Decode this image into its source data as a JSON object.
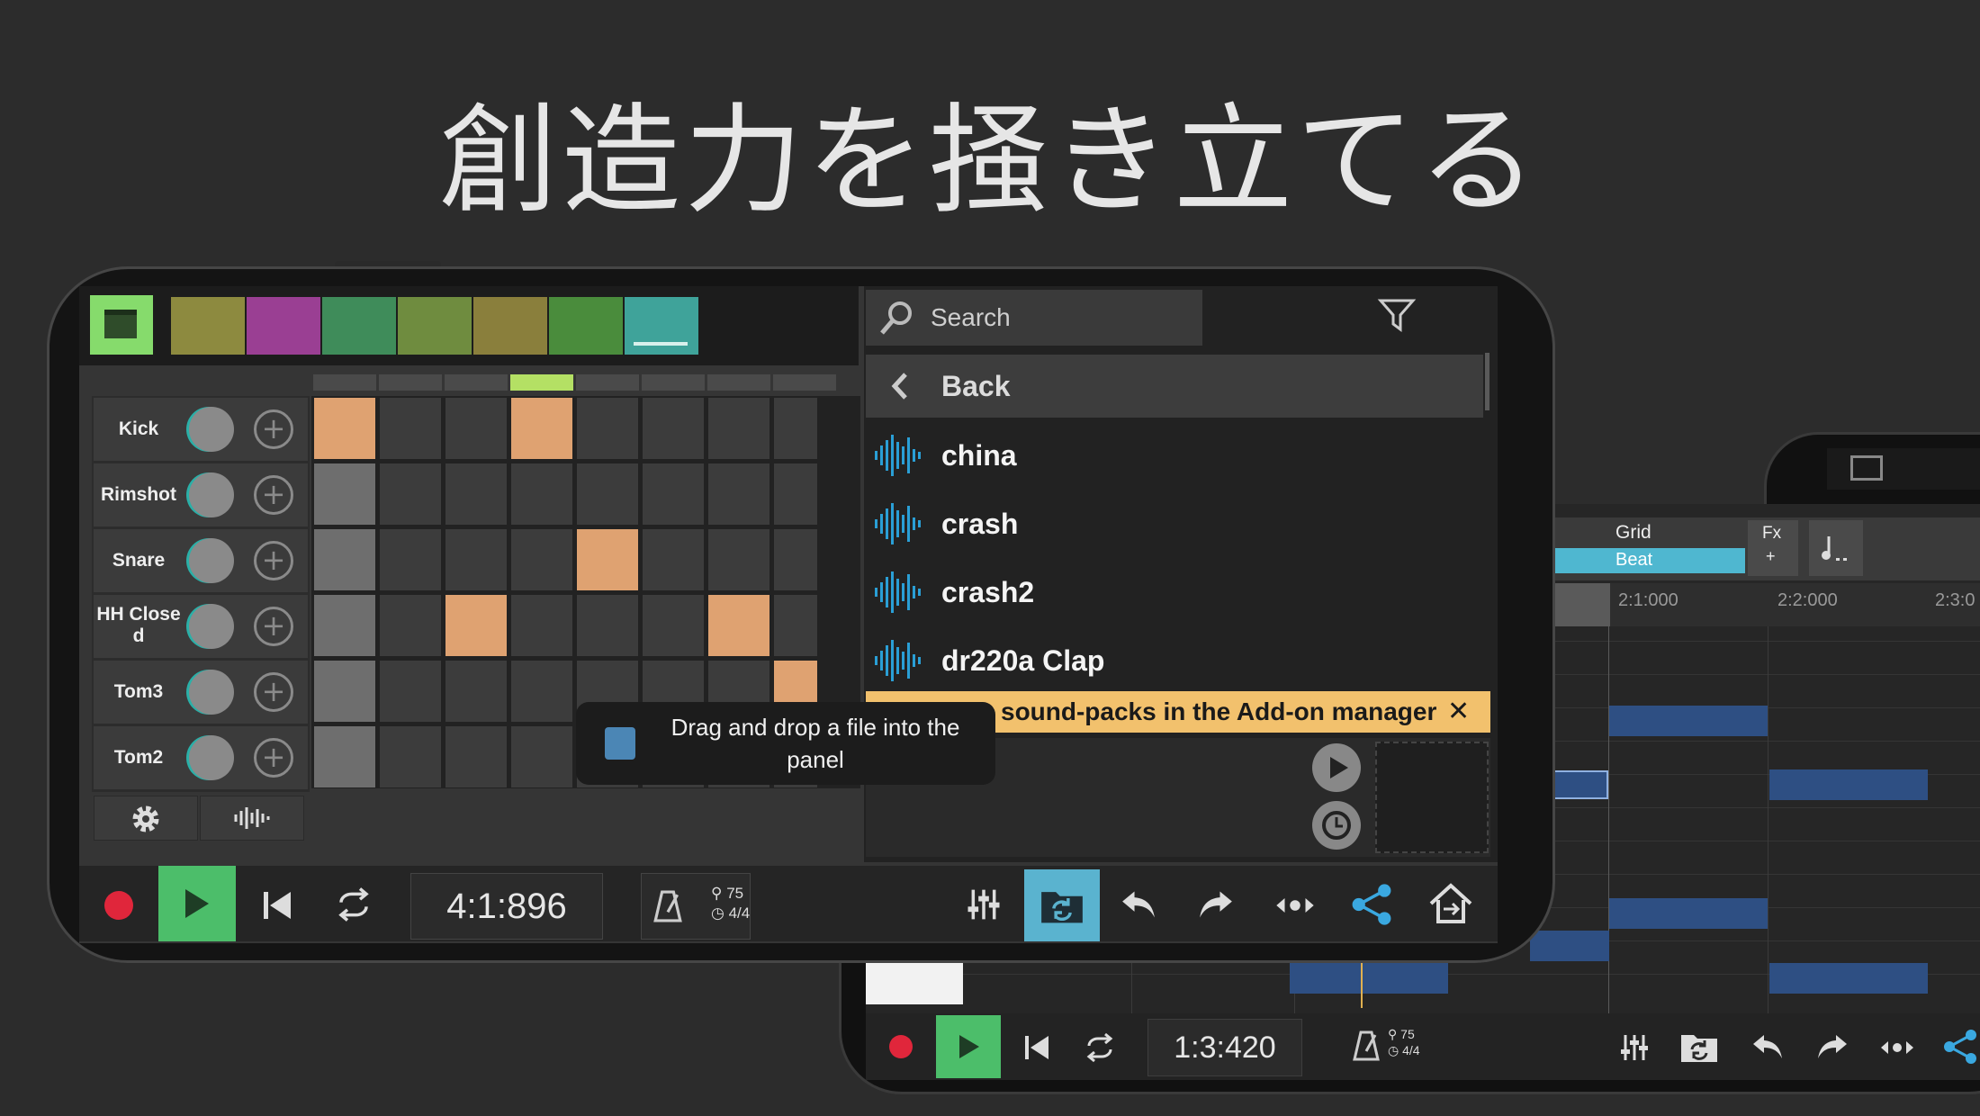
{
  "headline": "創造力を掻き立てる",
  "colors": {
    "accent_green": "#86db6c",
    "play_green": "#4cbe6a",
    "record_red": "#e0263b",
    "step_on": "#dfa271",
    "loop_blue": "#5ab3cf",
    "banner": "#f2c16d",
    "wave_blue": "#2a9fd6"
  },
  "clips": [
    "#8d8a3f",
    "#9a3f93",
    "#3f8c5a",
    "#6f8c3f",
    "#8a7f3c",
    "#4a8c3c",
    "#3fa39a"
  ],
  "tracks": [
    {
      "name": "Kick",
      "steps": [
        1,
        0,
        0,
        1,
        0,
        0,
        0,
        0
      ]
    },
    {
      "name": "Rimshot",
      "steps": [
        0,
        0,
        0,
        0,
        0,
        0,
        0,
        0
      ]
    },
    {
      "name": "Snare",
      "steps": [
        0,
        0,
        0,
        0,
        1,
        0,
        0,
        0
      ]
    },
    {
      "name": "HH Close\nd",
      "steps": [
        0,
        0,
        1,
        0,
        0,
        0,
        1,
        0
      ]
    },
    {
      "name": "Tom3",
      "steps": [
        0,
        0,
        0,
        0,
        0,
        0,
        0,
        1
      ]
    },
    {
      "name": "Tom2",
      "steps": [
        0,
        0,
        0,
        0,
        0,
        0,
        0,
        0
      ]
    }
  ],
  "browser": {
    "search_placeholder": "Search",
    "back_label": "Back",
    "files": [
      "china",
      "crash",
      "crash2",
      "dr220a Clap"
    ],
    "banner_text": "sound-packs in the Add-on manager",
    "banner_close": "✕"
  },
  "toast": {
    "text": "Drag and drop a file into the panel"
  },
  "transport": {
    "time": "4:1:896",
    "tempo": "75",
    "signature": "4/4"
  },
  "back_phone": {
    "grid_label": "Grid",
    "beat_label": "Beat",
    "fx_label": "Fx",
    "fx_plus": "+",
    "ruler": [
      "2:1:000",
      "2:2:000",
      "2:3:0"
    ],
    "time": "1:3:420",
    "tempo": "75",
    "signature": "4/4"
  }
}
